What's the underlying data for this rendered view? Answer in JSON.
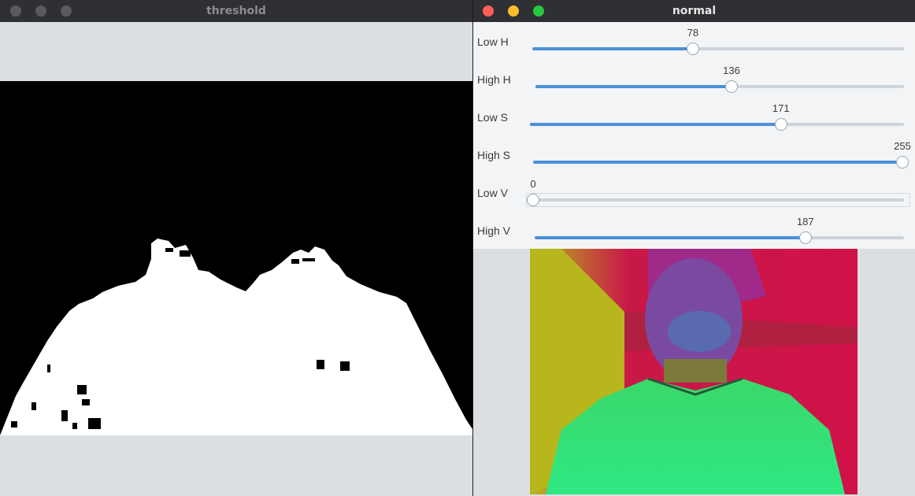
{
  "windows": {
    "threshold": {
      "title": "threshold"
    },
    "normal": {
      "title": "normal"
    }
  },
  "colors": {
    "close": "#ff5f57",
    "minimize": "#ffbd2e",
    "maximize": "#28c940",
    "inactive_dot": "#5a5b5e",
    "slider_fill": "#4a90d9",
    "slider_track": "#cdd3dc"
  },
  "trackbars": [
    {
      "label": "Low H",
      "value": "78",
      "fraction": 0.432
    },
    {
      "label": "High H",
      "value": "136",
      "fraction": 0.532
    },
    {
      "label": "Low S",
      "value": "171",
      "fraction": 0.671
    },
    {
      "label": "High S",
      "value": "255",
      "fraction": 1.0
    },
    {
      "label": "Low V",
      "value": "0",
      "fraction": 0.0
    },
    {
      "label": "High V",
      "value": "187",
      "fraction": 0.733
    }
  ]
}
